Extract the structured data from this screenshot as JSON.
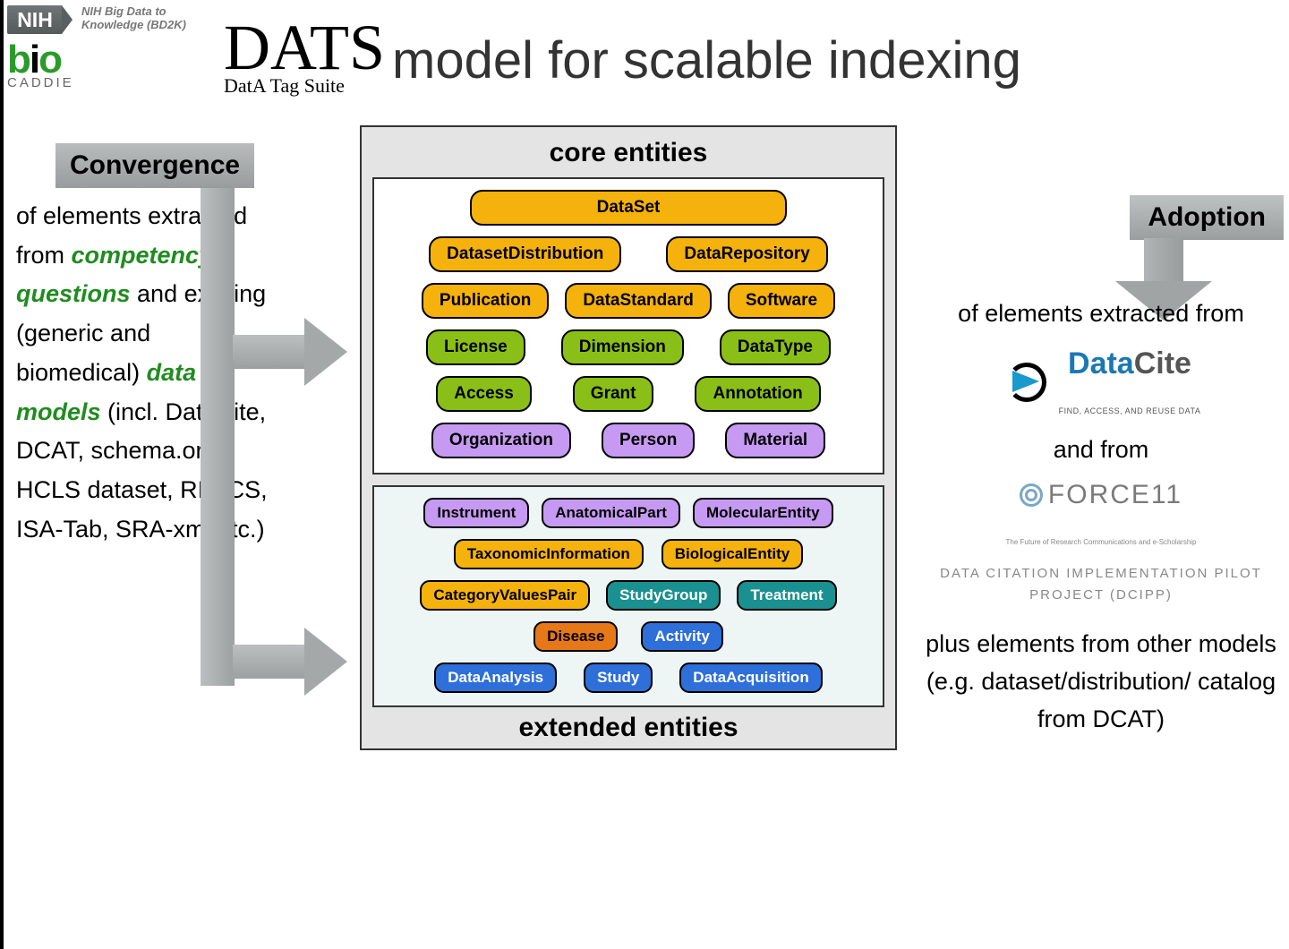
{
  "header": {
    "nih_logo": "NIH",
    "nih_sub": "NIH Big Data to\nKnowledge (BD2K)",
    "bio_b": "b",
    "bio_i": "i",
    "bio_o": "o",
    "caddie": "CADDIE",
    "dats": "DATS",
    "dats_sub": "DatA Tag Suite",
    "title_rest": "model for scalable indexing"
  },
  "left": {
    "band": "Convergence",
    "p1": "of elements extracted from",
    "em1": "competency questions",
    "p2": "and existing (generic and biomedical)",
    "em2": "data models",
    "p3": "(incl. DataCite, DCAT, schema.org, HCLS dataset, RIF-CS, ISA-Tab, SRA-xml etc.)"
  },
  "center": {
    "core_title": "core entities",
    "ext_title": "extended entities",
    "core": {
      "r1": [
        "DataSet"
      ],
      "r2": [
        "DatasetDistribution",
        "DataRepository"
      ],
      "r3": [
        "Publication",
        "DataStandard",
        "Software"
      ],
      "r4": [
        "License",
        "Dimension",
        "DataType"
      ],
      "r5": [
        "Access",
        "Grant",
        "Annotation"
      ],
      "r6": [
        "Organization",
        "Person",
        "Material"
      ]
    },
    "ext": {
      "r1": [
        "Instrument",
        "AnatomicalPart",
        "MolecularEntity"
      ],
      "r2": [
        "TaxonomicInformation",
        "BiologicalEntity"
      ],
      "r3": [
        "CategoryValuesPair",
        "StudyGroup",
        "Treatment"
      ],
      "r4": [
        "Disease",
        "Activity"
      ],
      "r5": [
        "DataAnalysis",
        "Study",
        "DataAcquisition"
      ]
    }
  },
  "right": {
    "band": "Adoption",
    "p1": "of elements extracted from",
    "datacite_blue": "Data",
    "datacite_gray": "Cite",
    "datacite_tag": "FIND, ACCESS, AND REUSE DATA",
    "p2": "and from",
    "force": "FORCE11",
    "force_tag": "The Future of Research Communications and e-Scholarship",
    "dcipp": "DATA CITATION IMPLEMENTATION PILOT PROJECT (DCIPP)",
    "p3": "plus elements from other models (e.g. dataset/distribution/ catalog from DCAT)"
  }
}
